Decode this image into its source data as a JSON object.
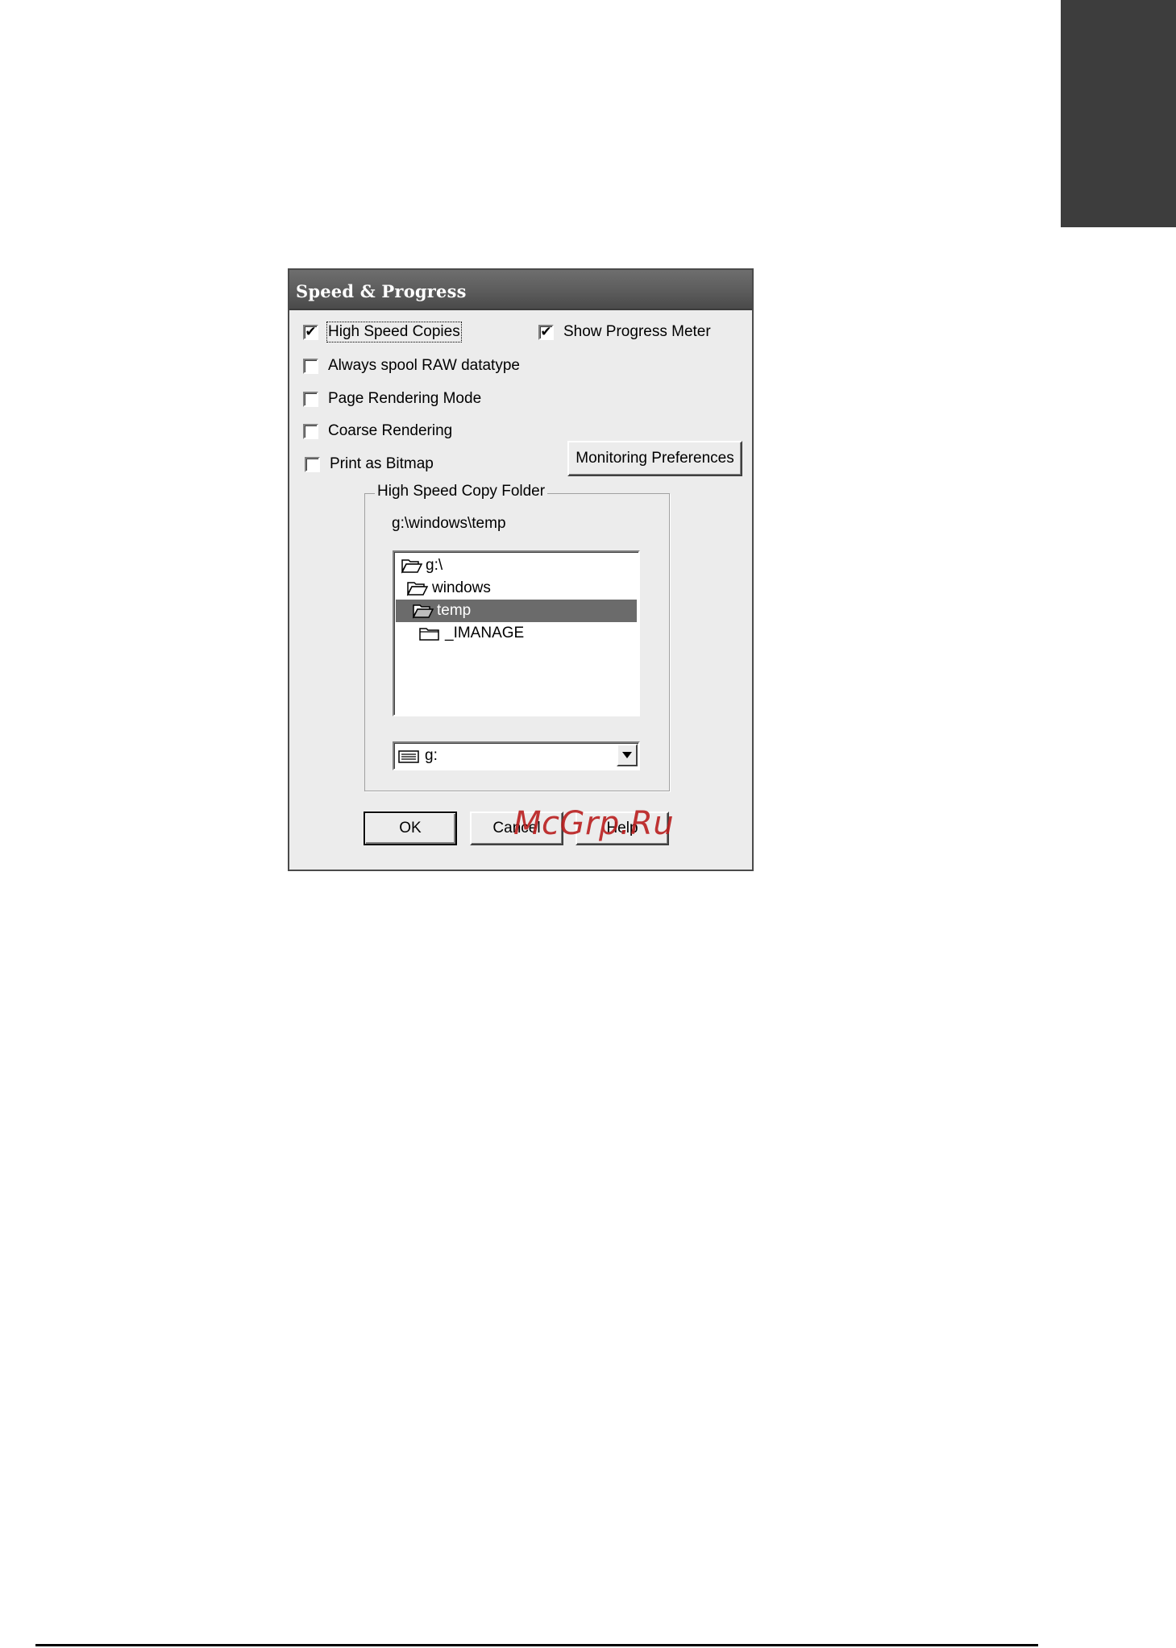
{
  "dialog": {
    "title": "Speed & Progress",
    "options": [
      {
        "label": "High Speed Copies",
        "checked": true
      },
      {
        "label": "Show Progress Meter",
        "checked": true
      },
      {
        "label": "Always spool RAW datatype",
        "checked": false
      },
      {
        "label": "Page Rendering Mode",
        "checked": false
      },
      {
        "label": "Coarse Rendering",
        "checked": false
      },
      {
        "label": "Print as Bitmap",
        "checked": false
      }
    ],
    "monitoring_button": "Monitoring Preferences",
    "folder_group": {
      "legend": "High Speed Copy Folder",
      "current_path": "g:\\windows\\temp",
      "tree": [
        {
          "label": "g:\\",
          "icon": "open-folder-icon",
          "selected": false
        },
        {
          "label": "windows",
          "icon": "open-folder-icon",
          "selected": false
        },
        {
          "label": "temp",
          "icon": "open-folder-icon",
          "selected": true
        },
        {
          "label": "_IMANAGE",
          "icon": "folder-icon",
          "selected": false
        }
      ],
      "drive": {
        "value": "g:",
        "icon": "drive-icon"
      }
    },
    "buttons": {
      "ok": "OK",
      "cancel": "Cancel",
      "help": "Help"
    }
  },
  "watermark": "McGrp.Ru"
}
